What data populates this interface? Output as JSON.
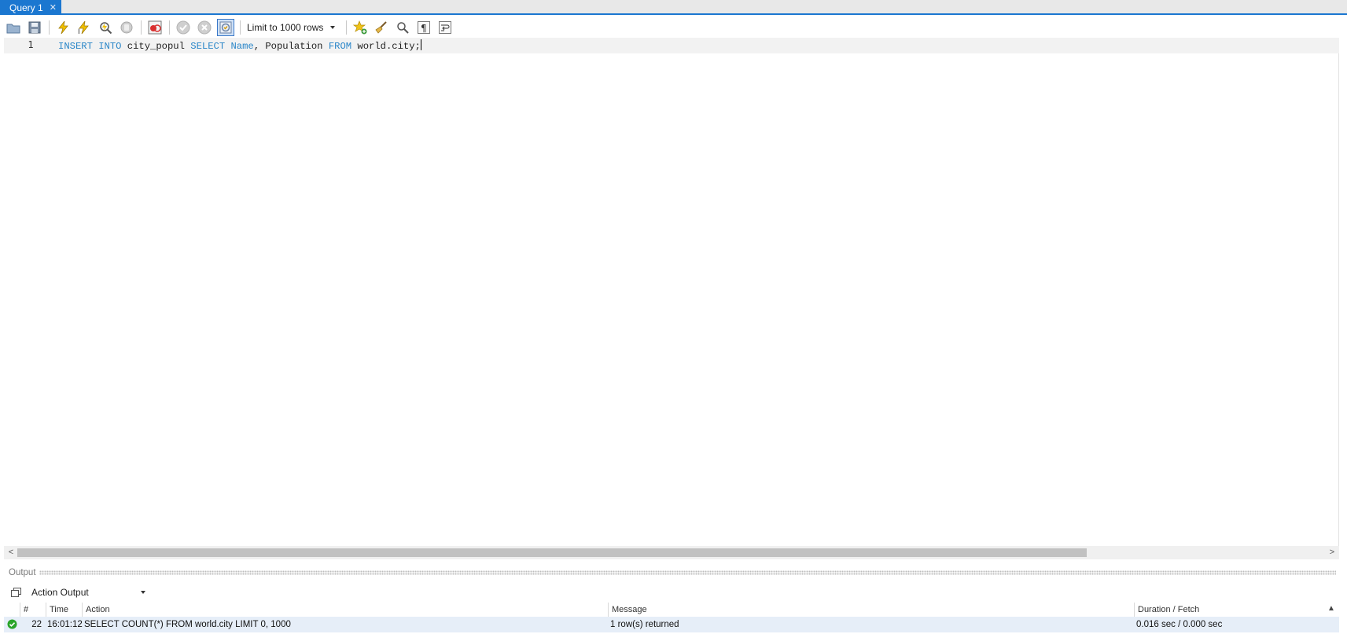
{
  "tab": {
    "title": "Query 1",
    "close_icon": "close-icon"
  },
  "toolbar": {
    "buttons": [
      {
        "name": "open-file-button",
        "icon": "folder-icon"
      },
      {
        "name": "save-button",
        "icon": "save-icon"
      },
      {
        "name": "execute-button",
        "icon": "lightning-icon"
      },
      {
        "name": "execute-current-button",
        "icon": "lightning-cursor-icon"
      },
      {
        "name": "explain-button",
        "icon": "magnifier-icon"
      },
      {
        "name": "stop-button",
        "icon": "stop-icon"
      },
      {
        "name": "toggle-continue-on-error-button",
        "icon": "error-stop-icon"
      },
      {
        "name": "commit-button",
        "icon": "check-icon"
      },
      {
        "name": "rollback-button",
        "icon": "cancel-icon"
      },
      {
        "name": "autocommit-toggle-button",
        "icon": "autocommit-icon"
      }
    ],
    "limit_label": "Limit to 1000 rows",
    "right_buttons": [
      {
        "name": "add-snippet-button",
        "icon": "star-icon"
      },
      {
        "name": "beautify-button",
        "icon": "broom-icon"
      },
      {
        "name": "find-button",
        "icon": "search-icon"
      },
      {
        "name": "invisible-chars-button",
        "icon": "pilcrow-icon"
      },
      {
        "name": "wrap-lines-button",
        "icon": "wrap-icon"
      }
    ]
  },
  "editor": {
    "line_number": "1",
    "tokens": [
      {
        "text": "INSERT",
        "kw": true
      },
      {
        "text": " ",
        "kw": false
      },
      {
        "text": "INTO",
        "kw": true
      },
      {
        "text": " city_popul ",
        "kw": false
      },
      {
        "text": "SELECT",
        "kw": true
      },
      {
        "text": " ",
        "kw": false
      },
      {
        "text": "Name",
        "kw": true
      },
      {
        "text": ", Population ",
        "kw": false
      },
      {
        "text": "FROM",
        "kw": true
      },
      {
        "text": " world.city;",
        "kw": false
      }
    ]
  },
  "output": {
    "header_label": "Output",
    "selector_value": "Action Output",
    "columns": {
      "num": "#",
      "time": "Time",
      "action": "Action",
      "message": "Message",
      "duration": "Duration / Fetch"
    },
    "rows": [
      {
        "status_icon": "success-check-icon",
        "num": "22",
        "time": "16:01:12",
        "action": "SELECT COUNT(*) FROM world.city LIMIT 0, 1000",
        "message": "1 row(s) returned",
        "duration": "0.016 sec / 0.000 sec"
      }
    ]
  },
  "colors": {
    "accent": "#1b77d0",
    "keyword": "#2a86c8",
    "row_highlight": "#e6eef8",
    "success": "#2aa52a"
  }
}
